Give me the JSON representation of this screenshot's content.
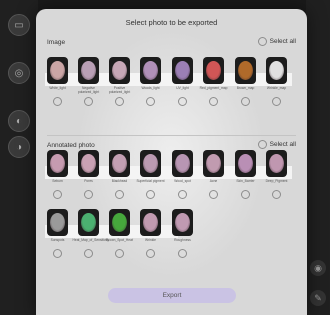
{
  "dialog": {
    "title": "Select photo to be exported",
    "export_label": "Export"
  },
  "image_section": {
    "label": "Image",
    "select_all": "Select all",
    "items": [
      {
        "label": "White_light",
        "color": "#caa5a5"
      },
      {
        "label": "Negative polarized_light",
        "color": "#b99fb5"
      },
      {
        "label": "Positive polarized_light",
        "color": "#c7a7b6"
      },
      {
        "label": "Woods_light",
        "color": "#b08fb8"
      },
      {
        "label": "UV_light",
        "color": "#9b7fb5"
      },
      {
        "label": "Red_pigment_map",
        "color": "#d05656"
      },
      {
        "label": "Brown_map",
        "color": "#b06a2a"
      },
      {
        "label": "Wrinkle_map",
        "color": "#e0e0e0"
      }
    ]
  },
  "annotated_section": {
    "label": "Annotated photo",
    "select_all": "Select all",
    "items": [
      {
        "label": "Sebum",
        "color": "#c69bb0"
      },
      {
        "label": "Pores",
        "color": "#c9a1b3"
      },
      {
        "label": "Blackhead",
        "color": "#c39fb3"
      },
      {
        "label": "Superficial pigment",
        "color": "#bb9ab1"
      },
      {
        "label": "Wood_spot",
        "color": "#b896b3"
      },
      {
        "label": "Acne",
        "color": "#c19bb0"
      },
      {
        "label": "Skin_Barrier",
        "color": "#b98fb5"
      },
      {
        "label": "Deep_Pigment",
        "color": "#c097b0"
      },
      {
        "label": "Sunspots",
        "color": "#9a9a9a"
      },
      {
        "label": "Heat_Map_of_Sensitivity",
        "color": "#4bb070"
      },
      {
        "label": "Brown_Spot_Heat",
        "color": "#46a83c"
      },
      {
        "label": "Wrinkle",
        "color": "#c19ab0"
      },
      {
        "label": "Roughness",
        "color": "#c09ab2"
      }
    ]
  }
}
